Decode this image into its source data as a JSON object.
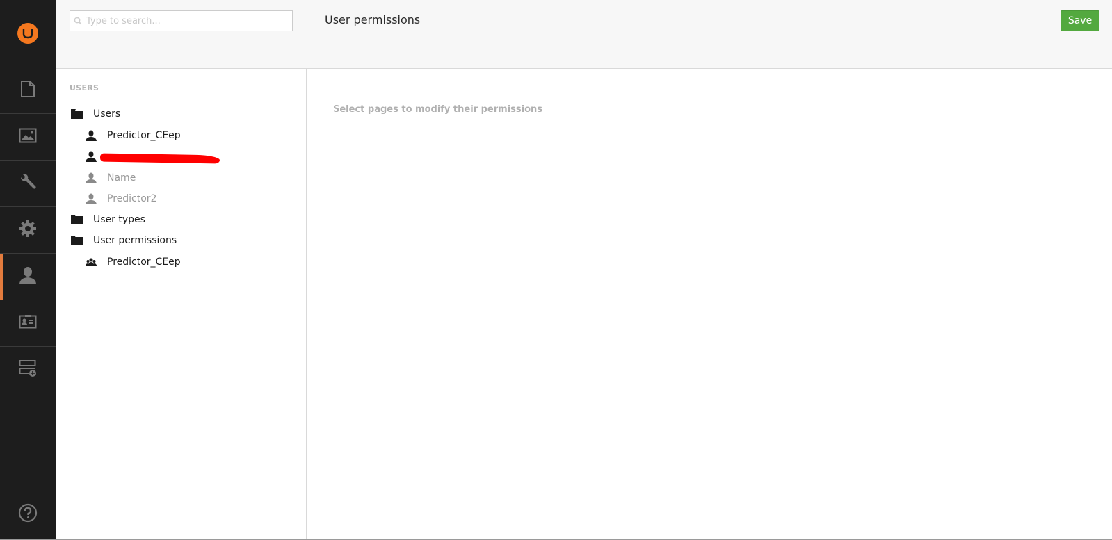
{
  "rail": {
    "logo": "umbraco-logo",
    "items": [
      {
        "name": "content",
        "icon": "document-icon",
        "active": false
      },
      {
        "name": "media",
        "icon": "image-icon",
        "active": false
      },
      {
        "name": "developer",
        "icon": "wrench-icon",
        "active": false
      },
      {
        "name": "settings",
        "icon": "gear-icon",
        "active": false
      },
      {
        "name": "users",
        "icon": "user-icon",
        "active": true
      },
      {
        "name": "members",
        "icon": "id-card-icon",
        "active": false
      },
      {
        "name": "forms",
        "icon": "form-add-icon",
        "active": false
      }
    ],
    "help_icon": "help-icon"
  },
  "tree": {
    "search_placeholder": "Type to search...",
    "section_title": "USERS",
    "nodes": [
      {
        "label": "Users",
        "icon": "folder-icon",
        "level": 1
      },
      {
        "label": "Predictor_CEep",
        "icon": "user-icon",
        "level": 2
      },
      {
        "label": "",
        "icon": "user-icon",
        "level": 2,
        "redacted": true
      },
      {
        "label": "Name",
        "icon": "user-icon",
        "level": 2,
        "disabled": true
      },
      {
        "label": "Predictor2",
        "icon": "user-icon",
        "level": 2,
        "disabled": true
      },
      {
        "label": "User types",
        "icon": "folder-icon",
        "level": 1
      },
      {
        "label": "User permissions",
        "icon": "folder-icon",
        "level": 1
      },
      {
        "label": "Predictor_CEep",
        "icon": "users-group-icon",
        "level": 2
      }
    ]
  },
  "main": {
    "title": "User permissions",
    "save_label": "Save",
    "empty_message": "Select pages to modify their permissions"
  },
  "colors": {
    "accent": "#f5781f",
    "active_indicator": "#e27b3d",
    "save": "#53a93f",
    "rail_bg": "#1d1d1d"
  }
}
